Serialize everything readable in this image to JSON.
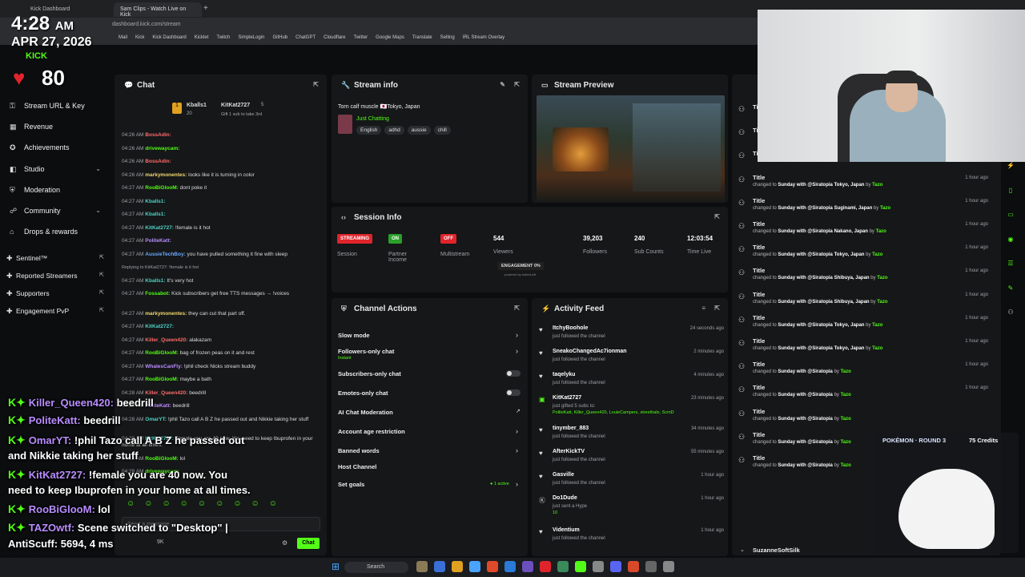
{
  "browser": {
    "tabs": [
      "Kick Dashboard",
      "Sam Clips - Watch Live on Kick"
    ],
    "new_tab": "+",
    "address": "dashboard.kick.com/stream",
    "bookmarks": [
      "Mail",
      "Kick",
      "Kick Dashboard",
      "Kicklet",
      "Twitch",
      "SimpleLogin",
      "GitHub",
      "ChatGPT",
      "Cloudflare",
      "Twitter",
      "Google Maps",
      "Translate",
      "Selling",
      "IRL Stream Overlay"
    ]
  },
  "overlay": {
    "time": "4:28",
    "ampm": "AM",
    "date": "APR 27, 2026",
    "heart_rate": "80",
    "brand": "KICK",
    "chat": [
      {
        "user": "Killer_Queen420:",
        "msg": "beedrill"
      },
      {
        "user": "PoliteKatt:",
        "msg": "beedrill"
      },
      {
        "user": "OmarYT:",
        "msg": "!phil Tazo call A B Z he passed out"
      },
      {
        "user": "",
        "msg": "and Nikkie taking her stuff"
      },
      {
        "user": "KitKat2727:",
        "msg": "!female you are 40 now. You"
      },
      {
        "user": "",
        "msg": "need to keep Ibuprofen in your home at all times."
      },
      {
        "user": "RooBiGlooM:",
        "msg": "lol"
      },
      {
        "user": "TAZOwtf:",
        "msg": "Scene switched to \"Desktop\" |"
      },
      {
        "user": "",
        "msg": "AntiScuff: 5694, 4 ms"
      },
      {
        "user": "drivewaycam:",
        "msg": ""
      }
    ],
    "pokemon": "POKÉMON · ROUND 3",
    "credits": "75 Credits"
  },
  "sidebar": {
    "items": [
      {
        "label": "Stream URL & Key",
        "icon": "key-icon",
        "chevron": false
      },
      {
        "label": "Revenue",
        "icon": "dollar-icon",
        "chevron": false
      },
      {
        "label": "Achievements",
        "icon": "trophy-icon",
        "chevron": false
      },
      {
        "label": "Studio",
        "icon": "studio-icon",
        "chevron": true
      },
      {
        "label": "Moderation",
        "icon": "moderation-icon",
        "chevron": false
      },
      {
        "label": "Community",
        "icon": "community-icon",
        "chevron": true
      },
      {
        "label": "Drops & rewards",
        "icon": "gift-icon",
        "chevron": false
      }
    ],
    "extensions": [
      "Sentinel™",
      "Reported Streamers",
      "Supporters",
      "Engagement PvP"
    ]
  },
  "chat": {
    "title": "Chat",
    "pinned_user1": "Kballs1",
    "pinned_user2": "KitKat2727",
    "pinned_count": "20",
    "pinned_count2": "5",
    "pinned_note": "Gift 1 sub to take 3rd",
    "messages": [
      {
        "time": "04:26 AM",
        "user": "BossAdin:",
        "color": "#ff6b6b",
        "text": ""
      },
      {
        "time": "04:26 AM",
        "user": "drivewaycam:",
        "color": "#53fc18",
        "text": ""
      },
      {
        "time": "04:26 AM",
        "user": "BossAdin:",
        "color": "#ff6b6b",
        "text": ""
      },
      {
        "time": "04:26 AM",
        "user": "markymonentes:",
        "color": "#f5d76e",
        "text": "looks like it is turning in color"
      },
      {
        "time": "04:27 AM",
        "user": "RooBiGlooM:",
        "color": "#53fc18",
        "text": "dont poke it"
      },
      {
        "time": "04:27 AM",
        "user": "Kballs1:",
        "color": "#4fd1c5",
        "text": ""
      },
      {
        "time": "04:27 AM",
        "user": "Kballs1:",
        "color": "#4fd1c5",
        "text": ""
      },
      {
        "time": "04:27 AM",
        "user": "KitKat2727:",
        "color": "#4fd1c5",
        "text": "!female is it hot"
      },
      {
        "time": "04:27 AM",
        "user": "PoliteKatt:",
        "color": "#b98cff",
        "text": ""
      },
      {
        "time": "04:27 AM",
        "user": "AussieTechBoy:",
        "color": "#6aa9ff",
        "text": "you have pulled something it fine with sleep"
      },
      {
        "time": "",
        "user": "Replying to KitKat2727: !female is it hot",
        "color": "#9ea2a6",
        "text": ""
      },
      {
        "time": "04:27 AM",
        "user": "Kballs1:",
        "color": "#4fd1c5",
        "text": "It's very hot"
      },
      {
        "time": "04:27 AM",
        "user": "Fossabot:",
        "color": "#53fc18",
        "text": "Kick subscribers get free TTS messages → !voices"
      },
      {
        "time": "04:27 AM",
        "user": "markymonentes:",
        "color": "#f5d76e",
        "text": "they can cut that part off."
      },
      {
        "time": "04:27 AM",
        "user": "KitKat2727:",
        "color": "#4fd1c5",
        "text": ""
      },
      {
        "time": "04:27 AM",
        "user": "Killer_Queen420:",
        "color": "#ff6b6b",
        "text": "alakazam"
      },
      {
        "time": "04:27 AM",
        "user": "RooBiGlooM:",
        "color": "#53fc18",
        "text": "bag of frozen peas on it and rest"
      },
      {
        "time": "04:27 AM",
        "user": "WhalesCanFly:",
        "color": "#b98cff",
        "text": "!phil check Nicks stream buddy"
      },
      {
        "time": "04:27 AM",
        "user": "RooBiGlooM:",
        "color": "#53fc18",
        "text": "maybe a bath"
      },
      {
        "time": "04:28 AM",
        "user": "Killer_Queen420:",
        "color": "#ff6b6b",
        "text": "beedrill"
      },
      {
        "time": "04:28 AM",
        "user": "PoliteKatt:",
        "color": "#b98cff",
        "text": "beedrill"
      },
      {
        "time": "04:28 AM",
        "user": "OmarYT:",
        "color": "#4fd1c5",
        "text": "!phil Tazo call A B Z he passed out and Nikkie taking her stuff"
      },
      {
        "time": "04:28 AM",
        "user": "KitKat2727:",
        "color": "#4fd1c5",
        "text": "!female you are 40 now. You need to keep Ibuprofen in your home at all times."
      },
      {
        "time": "04:28 AM",
        "user": "RooBiGlooM:",
        "color": "#53fc18",
        "text": "lol"
      },
      {
        "time": "04:28 AM",
        "user": "drivewaycam:",
        "color": "#53fc18",
        "text": ""
      }
    ],
    "input_placeholder": "Send a message",
    "viewer_count": "9K",
    "send_label": "Chat"
  },
  "stream_info": {
    "title": "Stream info",
    "stream_title": "Torn calf muscle 🇯🇵Tokyo, Japan",
    "category": "Just Chatting",
    "tags": [
      "English",
      "adhd",
      "aussie",
      "chill"
    ]
  },
  "preview": {
    "title": "Stream Preview"
  },
  "session": {
    "title": "Session Info",
    "streaming_badge": "STREAMING",
    "session_label": "Session",
    "partner_badge": "ON",
    "partner_label": "Partner Income",
    "multi_badge": "OFF",
    "multi_label": "Multistream",
    "viewers": "544",
    "viewers_label": "Viewers",
    "engagement": "ENGAGEMENT 0%",
    "engagement_note": "powered by botted.wtf",
    "followers": "39,203",
    "followers_label": "Followers",
    "subs": "240",
    "subs_label": "Sub Counts",
    "time_live": "12:03:54",
    "time_live_label": "Time Live"
  },
  "channel_actions": {
    "title": "Channel Actions",
    "items": [
      {
        "label": "Slow mode",
        "control": "arrow"
      },
      {
        "label": "Followers-only chat",
        "note": "Instant",
        "control": "arrow"
      },
      {
        "label": "Subscribers-only chat",
        "control": "toggle"
      },
      {
        "label": "Emotes-only chat",
        "control": "toggle"
      },
      {
        "label": "AI Chat Moderation",
        "control": "external"
      },
      {
        "label": "Account age restriction",
        "control": "arrow"
      },
      {
        "label": "Banned words",
        "control": "arrow"
      },
      {
        "label": "Host Channel",
        "control": "none"
      },
      {
        "label": "Set goals",
        "note": "1 active",
        "control": "arrow"
      }
    ]
  },
  "activity": {
    "title": "Activity Feed",
    "items": [
      {
        "name": "ItchyBoohole",
        "sub": "just followed the channel",
        "time": "24 seconds ago",
        "icon": "heart-icon"
      },
      {
        "name": "SneakoChangedAc7ionman",
        "sub": "just followed the channel",
        "time": "2 minutes ago",
        "icon": "heart-icon"
      },
      {
        "name": "taqelyku",
        "sub": "just followed the channel",
        "time": "4 minutes ago",
        "icon": "heart-icon"
      },
      {
        "name": "KitKat2727",
        "sub": "just gifted 5 subs to:",
        "extra": "PoliteKatt, Killer_Queen420, LouieCampers, streethalo, ScmD",
        "time": "23 minutes ago",
        "icon": "gift-icon"
      },
      {
        "name": "tinymber_883",
        "sub": "just followed the channel",
        "time": "34 minutes ago",
        "icon": "heart-icon"
      },
      {
        "name": "AfterKickTV",
        "sub": "just followed the channel",
        "time": "55 minutes ago",
        "icon": "heart-icon"
      },
      {
        "name": "Gasville",
        "sub": "just followed the channel",
        "time": "1 hour ago",
        "icon": "heart-icon"
      },
      {
        "name": "Do1Dude",
        "sub": "just sent a Hype",
        "extra": "10",
        "time": "1 hour ago",
        "icon": "kick-icon"
      },
      {
        "name": "Videntium",
        "sub": "just followed the channel",
        "time": "1 hour ago",
        "icon": "heart-icon"
      }
    ]
  },
  "history": {
    "items": [
      {
        "title": "Title",
        "loc": "Suginami, Japan",
        "time": "1 hour ago"
      },
      {
        "title": "Title",
        "loc": "Tokyo, Japan",
        "time": "1 hour ago"
      },
      {
        "title": "Title",
        "loc": "Suginami, Japan",
        "time": "1 hour ago"
      },
      {
        "title": "Title",
        "loc": "Tokyo, Japan",
        "time": "1 hour ago"
      },
      {
        "title": "Title",
        "loc": "Suginami, Japan",
        "time": "1 hour ago"
      },
      {
        "title": "Title",
        "loc": "Nakano, Japan",
        "time": "1 hour ago"
      },
      {
        "title": "Title",
        "loc": "Tokyo, Japan",
        "time": "1 hour ago"
      },
      {
        "title": "Title",
        "loc": "Shibuya, Japan",
        "time": "1 hour ago"
      },
      {
        "title": "Title",
        "loc": "Shibuya, Japan",
        "time": "1 hour ago"
      },
      {
        "title": "Title",
        "loc": "Tokyo, Japan",
        "time": "1 hour ago"
      },
      {
        "title": "Title",
        "loc": "Tokyo, Japan",
        "time": "1 hour ago"
      },
      {
        "title": "Title",
        "loc": "",
        "time": "1 hour ago"
      },
      {
        "title": "Title",
        "loc": "",
        "time": "1 hour ago"
      },
      {
        "title": "Title",
        "loc": "",
        "time": ""
      },
      {
        "title": "Title",
        "loc": "",
        "time": ""
      },
      {
        "title": "Title",
        "loc": "",
        "time": ""
      }
    ],
    "changed_prefix": "changed to",
    "stream_name": "Sunday with @Siratopia",
    "by": "by",
    "author": "Tazo",
    "footer_user": "SuzanneSoftSilk"
  },
  "taskbar": {
    "search": "Search"
  },
  "colors": {
    "kick_green": "#53fc18",
    "bg": "#0b0d0e",
    "panel": "#151718",
    "streaming_red": "#e0242b"
  }
}
